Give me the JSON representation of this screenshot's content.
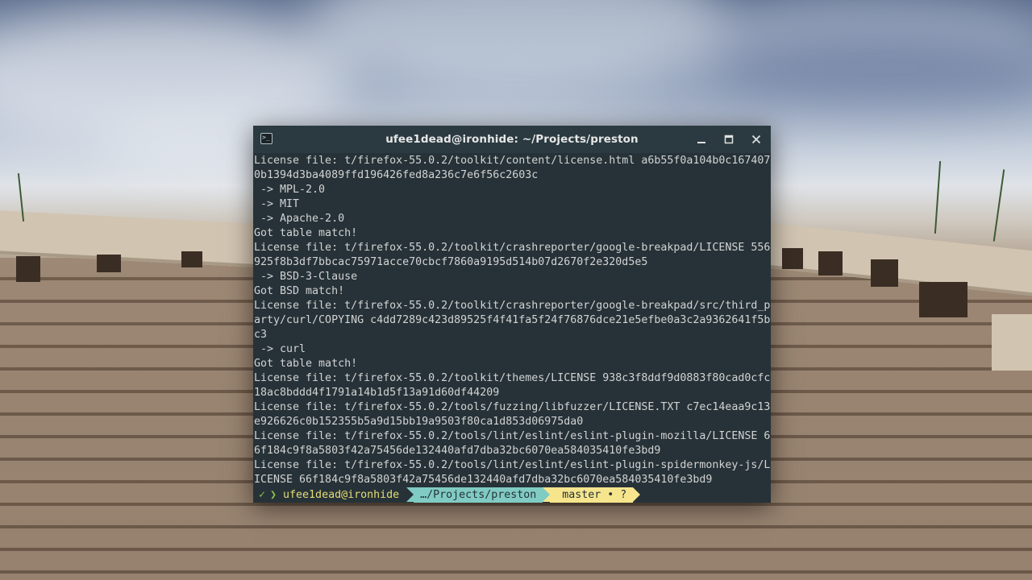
{
  "window": {
    "title": "ufee1dead@ironhide: ~/Projects/preston",
    "app_icon_glyph": ">_"
  },
  "terminal": {
    "lines": [
      "License file: t/firefox-55.0.2/toolkit/content/license.html a6b55f0a104b0c167407",
      "0b1394d3ba4089ffd196426fed8a236c7e6f56c2603c",
      " -> MPL-2.0",
      " -> MIT",
      " -> Apache-2.0",
      "Got table match!",
      "License file: t/firefox-55.0.2/toolkit/crashreporter/google-breakpad/LICENSE 556",
      "925f8b3df7bbcac75971acce70cbcf7860a9195d514b07d2670f2e320d5e5",
      " -> BSD-3-Clause",
      "Got BSD match!",
      "License file: t/firefox-55.0.2/toolkit/crashreporter/google-breakpad/src/third_p",
      "arty/curl/COPYING c4dd7289c423d89525f4f41fa5f24f76876dce21e5efbe0a3c2a9362641f5b",
      "c3",
      " -> curl",
      "Got table match!",
      "License file: t/firefox-55.0.2/toolkit/themes/LICENSE 938c3f8ddf9d0883f80cad0cfc",
      "18ac8bddd4f1791a14b1d5f13a91d60df44209",
      "License file: t/firefox-55.0.2/tools/fuzzing/libfuzzer/LICENSE.TXT c7ec14eaa9c13",
      "e926626c0b152355b5a9d15bb19a9503f80ca1d853d06975da0",
      "License file: t/firefox-55.0.2/tools/lint/eslint/eslint-plugin-mozilla/LICENSE 6",
      "6f184c9f8a5803f42a75456de132440afd7dba32bc6070ea584035410fe3bd9",
      "License file: t/firefox-55.0.2/tools/lint/eslint/eslint-plugin-spidermonkey-js/L",
      "ICENSE 66f184c9f8a5803f42a75456de132440afd7dba32bc6070ea584035410fe3bd9"
    ]
  },
  "prompt": {
    "status_icon": "✓",
    "chevron": "❯",
    "user_host": "ufee1dead@ironhide",
    "path": "…/Projects/preston",
    "git_icon": "",
    "branch": "master • ?"
  },
  "colors": {
    "terminal_bg": "#263238",
    "titlebar_bg": "#2b3a41",
    "text": "#d3d3d3",
    "status_ok": "#8bc34a",
    "user_host": "#e6db74",
    "path_bg": "#80cbc4",
    "git_bg": "#f6e58d"
  },
  "icons": {
    "minimize": "minimize-icon",
    "maximize": "maximize-icon",
    "close": "close-icon"
  }
}
